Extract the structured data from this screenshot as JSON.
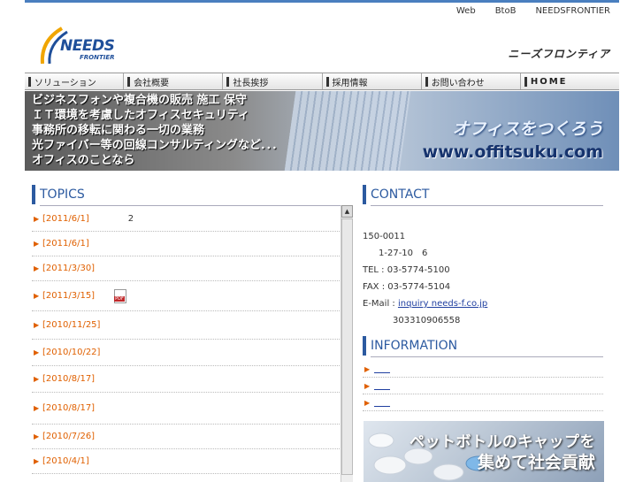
{
  "header": {
    "top_links": [
      "Web",
      "BtoB",
      "NEEDSFRONTIER"
    ],
    "logo_text": "NEEDS",
    "logo_subtext": "FRONTIER",
    "brand_kana": "ニーズフロンティア"
  },
  "nav": {
    "items": [
      "ソリューション",
      "会社概要",
      "社長挨拶",
      "採用情報",
      "お問い合わせ",
      "HOME"
    ]
  },
  "hero": {
    "lines": [
      "ビジネスフォンや複合機の販売 施工 保守",
      "ＩＴ環境を考慮したオフィスセキュリティ",
      "事務所の移転に関わる一切の業務",
      "光ファイバー等の回線コンサルティングなど．．．",
      "オフィスのことなら"
    ],
    "catch": "オフィスをつくろう",
    "url": "www.offitsuku.com"
  },
  "topics": {
    "title": "TOPICS",
    "items": [
      {
        "date": "[2011/6/1]",
        "text": "2",
        "link": false,
        "pdf": false
      },
      {
        "date": "[2011/6/1]",
        "text": "",
        "link": false,
        "pdf": false
      },
      {
        "date": "[2011/3/30]",
        "text": "",
        "link": true,
        "pdf": false
      },
      {
        "date": "[2011/3/15]",
        "text": "",
        "link": true,
        "pdf": true
      },
      {
        "date": "[2010/11/25]",
        "text": "",
        "link": false,
        "pdf": false
      },
      {
        "date": "[2010/10/22]",
        "text": "",
        "link": false,
        "pdf": false
      },
      {
        "date": "[2010/8/17]",
        "text": "",
        "link": false,
        "pdf": false
      },
      {
        "date": "[2010/8/17]",
        "text": "",
        "link": true,
        "pdf": false
      },
      {
        "date": "[2010/7/26]",
        "text": "",
        "link": true,
        "pdf": false
      },
      {
        "date": "[2010/4/1]",
        "text": "",
        "link": false,
        "pdf": false
      }
    ]
  },
  "contact": {
    "title": "CONTACT",
    "postal": "150-0011",
    "address": "1-27-10　6",
    "tel": "TEL : 03-5774-5100",
    "fax": "FAX : 03-5774-5104",
    "email_label": "E-Mail : ",
    "email": "inquiry needs-f.co.jp",
    "license": "303310906558"
  },
  "information": {
    "title": "INFORMATION",
    "items": [
      "",
      "",
      ""
    ]
  },
  "banner": {
    "line1": "ペットボトルのキャップを",
    "line2": "集めて社会貢献"
  },
  "colors": {
    "accent": "#2c5aa0",
    "date_orange": "#e06000",
    "link_blue": "#1f3fa0"
  }
}
